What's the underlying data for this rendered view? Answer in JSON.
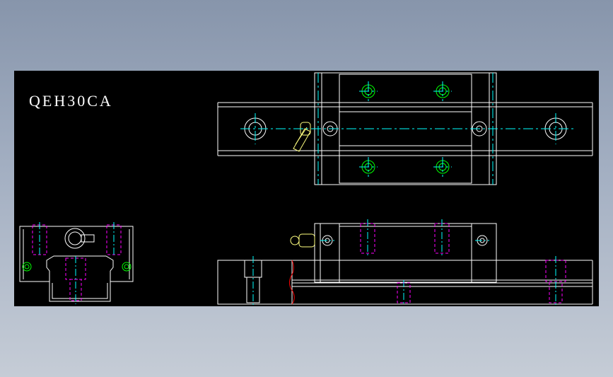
{
  "drawing": {
    "title": "QEH30CA"
  },
  "colors": {
    "background": "#000000",
    "outline": "#ffffff",
    "centerline": "#00ffff",
    "hidden": "#ff00ff",
    "bolt": "#00ff00",
    "break_line": "#ff0000",
    "fitting": "#ffff80"
  }
}
